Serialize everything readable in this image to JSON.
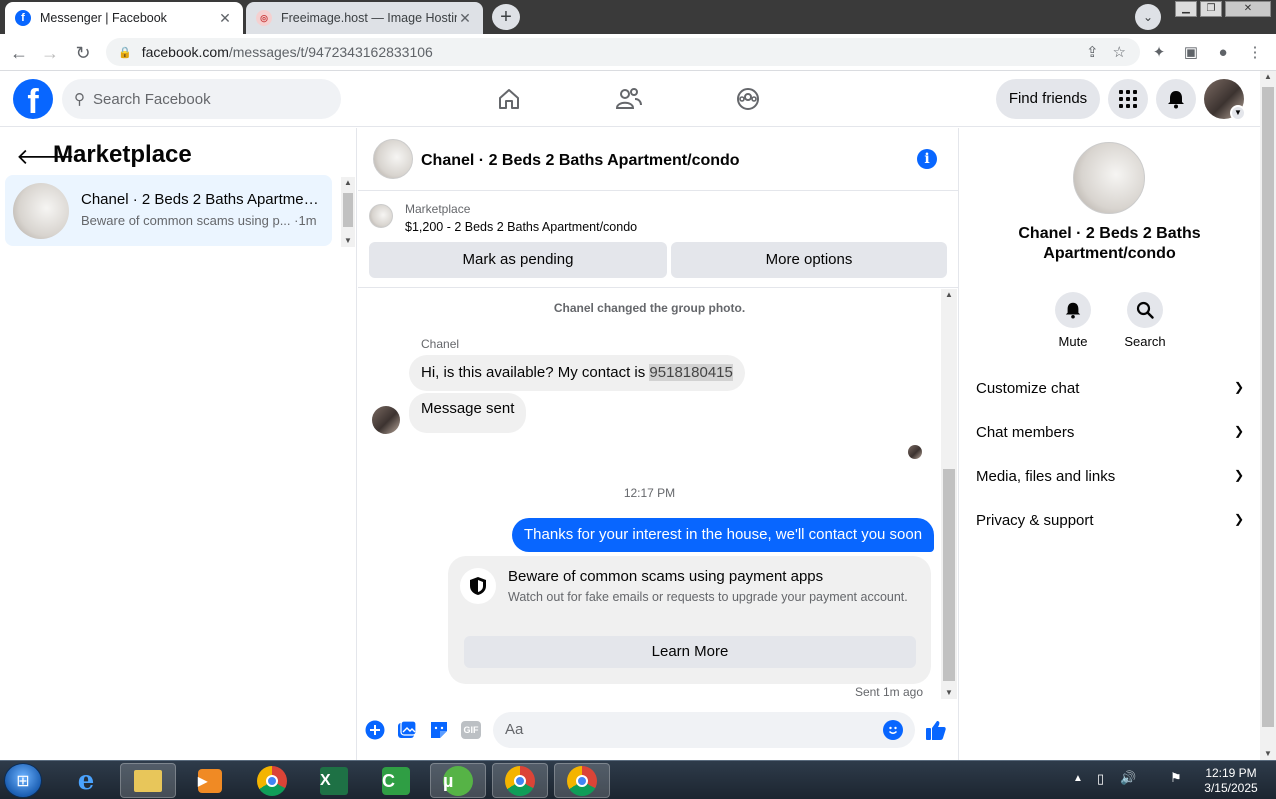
{
  "browser": {
    "tabs": [
      {
        "title": "Messenger | Facebook",
        "active": true
      },
      {
        "title": "Freeimage.host — Image Hosting",
        "active": false
      }
    ],
    "url_domain": "facebook.com",
    "url_path": "/messages/t/9472343162833106"
  },
  "header": {
    "search_placeholder": "Search Facebook",
    "find_friends": "Find friends"
  },
  "left_panel": {
    "title": "Marketplace",
    "conversations": [
      {
        "name": "Chanel · 2 Beds 2 Baths Apartment/condo",
        "preview": "Beware of common scams using p...",
        "time": "·1m"
      }
    ]
  },
  "chat": {
    "title": "Chanel · 2 Beds 2 Baths Apartment/condo",
    "marketplace_label": "Marketplace",
    "listing": "$1,200 - 2 Beds 2 Baths Apartment/condo",
    "mark_pending": "Mark as pending",
    "more_options": "More options",
    "system_message": "Chanel changed the group photo.",
    "sender_name": "Chanel",
    "message1_text": "Hi, is this available? My contact is ",
    "message1_highlight": "9518180415",
    "message2": "Message sent",
    "timestamp": "12:17 PM",
    "outgoing": "Thanks for your interest in the house, we'll contact you soon",
    "scam_title": "Beware of common scams using payment apps",
    "scam_body": "Watch out for fake emails or requests to upgrade your payment account.",
    "learn_more": "Learn More",
    "sent_status": "Sent 1m ago",
    "composer_placeholder": "Aa",
    "gif_label": "GIF"
  },
  "right_panel": {
    "name": "Chanel · 2 Beds 2 Baths Apartment/condo",
    "mute": "Mute",
    "search": "Search",
    "sections": [
      "Customize chat",
      "Chat members",
      "Media, files and links",
      "Privacy & support"
    ]
  },
  "taskbar": {
    "time": "12:19 PM",
    "date": "3/15/2025"
  },
  "colors": {
    "accent": "#0866ff",
    "selected_conv": "#ebf5ff"
  }
}
